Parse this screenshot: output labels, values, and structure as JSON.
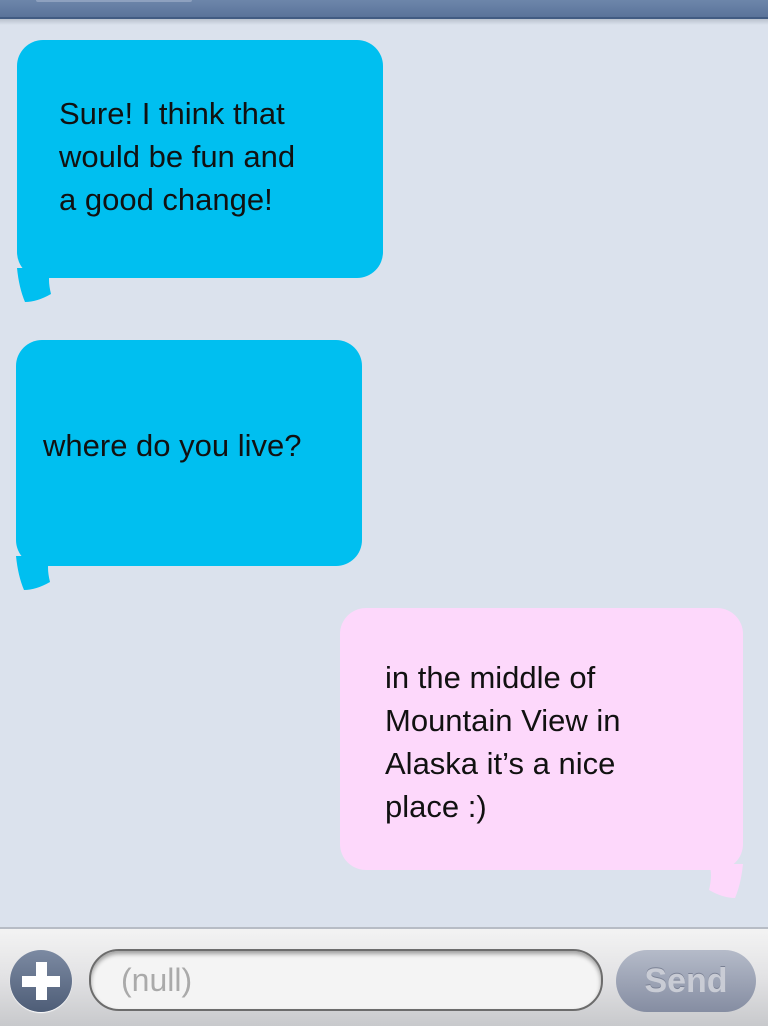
{
  "messages": [
    {
      "side": "received",
      "lines": [
        "Sure!  I think that",
        "would be fun and",
        "a good change!"
      ]
    },
    {
      "side": "received",
      "lines": [
        "where do you live?"
      ]
    },
    {
      "side": "sent",
      "lines": [
        "in the middle of",
        "Mountain View in",
        "Alaska it’s a nice",
        "place :)"
      ]
    }
  ],
  "input": {
    "placeholder": "(null)",
    "send_label": "Send",
    "add_icon": "plus-icon"
  },
  "colors": {
    "received": "#00bff0",
    "sent": "#fdd8fb",
    "background": "#dbe2ed"
  }
}
